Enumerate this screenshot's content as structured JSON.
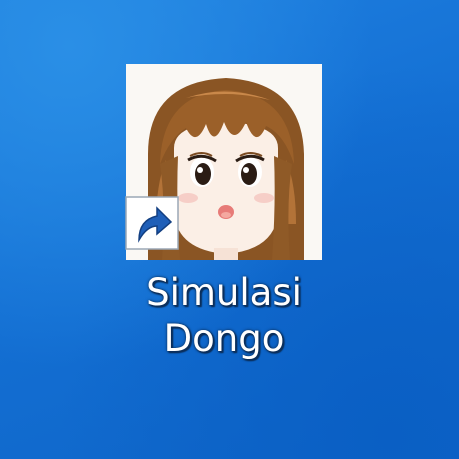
{
  "desktop": {
    "background_color": "#1673d6",
    "shortcut": {
      "label_line1": "Simulasi",
      "label_line2": "Dongo",
      "icon": "anime-girl-face-icon",
      "overlay_icon": "shortcut-arrow-icon"
    }
  }
}
